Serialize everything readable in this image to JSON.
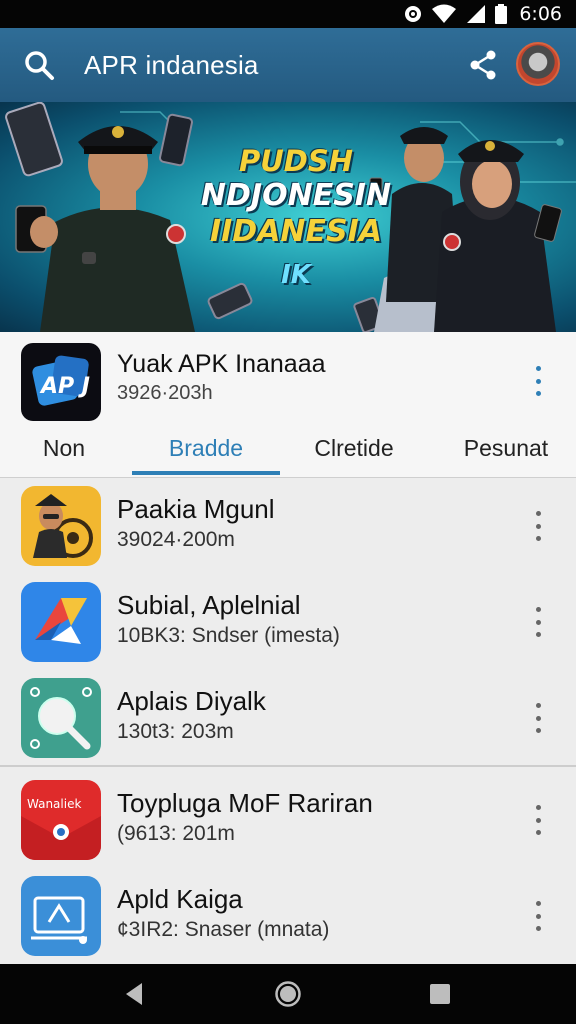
{
  "status_bar": {
    "time": "6:06",
    "icons": [
      "sync-icon",
      "wifi-icon",
      "signal-icon",
      "battery-icon"
    ]
  },
  "app_bar": {
    "title": "APR indanesia",
    "icons": [
      "search-icon",
      "share-icon"
    ]
  },
  "banner": {
    "line1": "PUDSH",
    "line2": "NDJONESIN",
    "line3": "IIDANESIA",
    "line4": "IK"
  },
  "app_header": {
    "name": "Yuak APK Inanaaa",
    "meta": "3926·203h",
    "icon_text": "AP J"
  },
  "tabs": [
    {
      "label": "Non",
      "active": false
    },
    {
      "label": "Bradde",
      "active": true
    },
    {
      "label": "Clretide",
      "active": false
    },
    {
      "label": "Pesunat",
      "active": false
    }
  ],
  "list": [
    {
      "name": "Paakia Mgunl",
      "meta": "39024·200m"
    },
    {
      "name": "Subial, Aplelnial",
      "meta": "10BK3: Sndser (imesta)"
    },
    {
      "name": "Aplais Diyalk",
      "meta": "130t3: 203m"
    },
    {
      "name": "Toypluga MoF Rariran",
      "meta": "(9613: 201m",
      "icon_text": "Wanaliek"
    },
    {
      "name": "Apld Kaiga",
      "meta": "¢3IR2: Snaser (mnata)"
    }
  ],
  "colors": {
    "app_bar": "#2a6389",
    "accent": "#2e7fb6",
    "banner_text": "#f5d23a"
  }
}
